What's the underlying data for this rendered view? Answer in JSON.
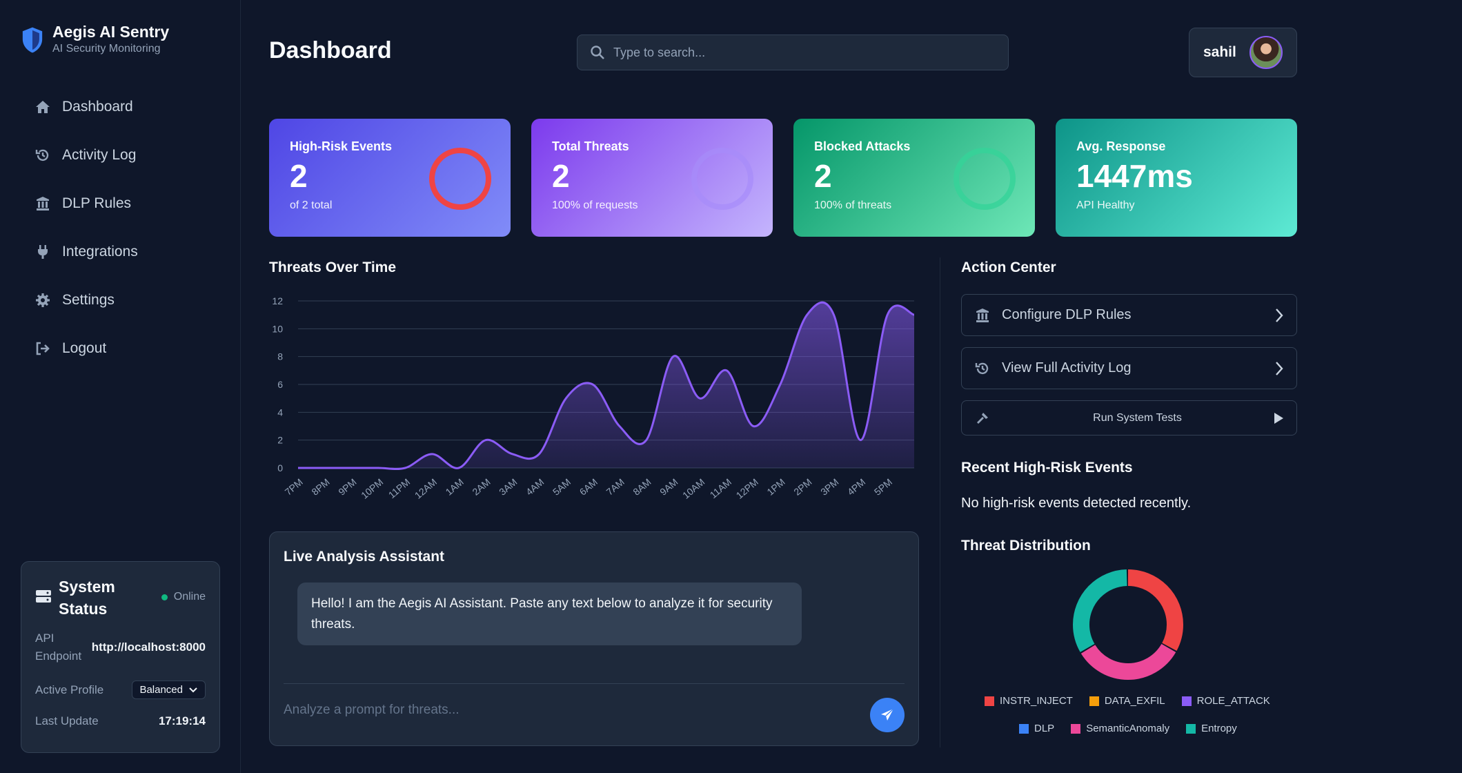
{
  "brand": {
    "title": "Aegis AI Sentry",
    "subtitle": "AI Security Monitoring"
  },
  "nav": [
    {
      "label": "Dashboard",
      "icon": "home-icon"
    },
    {
      "label": "Activity Log",
      "icon": "history-icon"
    },
    {
      "label": "DLP Rules",
      "icon": "building-icon"
    },
    {
      "label": "Integrations",
      "icon": "plug-icon"
    },
    {
      "label": "Settings",
      "icon": "gear-icon"
    },
    {
      "label": "Logout",
      "icon": "logout-icon"
    }
  ],
  "system_status": {
    "title": "System Status",
    "state": "Online",
    "api_label": "API Endpoint",
    "api_value": "http://localhost:8000",
    "profile_label": "Active Profile",
    "profile_value": "Balanced",
    "update_label": "Last Update",
    "update_value": "17:19:14"
  },
  "header": {
    "title": "Dashboard",
    "search_placeholder": "Type to search...",
    "user_name": "sahil"
  },
  "stats": [
    {
      "label": "High-Risk Events",
      "value": "2",
      "sub": "of 2 total",
      "ring_color": "#ef4444"
    },
    {
      "label": "Total Threats",
      "value": "2",
      "sub": "100% of requests",
      "ring_color": "#a78bfa"
    },
    {
      "label": "Blocked Attacks",
      "value": "2",
      "sub": "100% of threats",
      "ring_color": "#34d399"
    },
    {
      "label": "Avg. Response",
      "value": "1447ms",
      "sub": "API Healthy"
    }
  ],
  "threats_chart": {
    "title": "Threats Over Time"
  },
  "chart_data": {
    "type": "area",
    "title": "Threats Over Time",
    "categories": [
      "7PM",
      "8PM",
      "9PM",
      "10PM",
      "11PM",
      "12AM",
      "1AM",
      "2AM",
      "3AM",
      "4AM",
      "5AM",
      "6AM",
      "7AM",
      "8AM",
      "9AM",
      "10AM",
      "11AM",
      "12PM",
      "1PM",
      "2PM",
      "3PM",
      "4PM",
      "5PM"
    ],
    "values": [
      0,
      0,
      0,
      0,
      0,
      1,
      0,
      2,
      1,
      1,
      5,
      6,
      3,
      2,
      8,
      5,
      7,
      3,
      6,
      11,
      11,
      2,
      11,
      11
    ],
    "x_positions": [
      0,
      1,
      2,
      3,
      4,
      5,
      6,
      7,
      8,
      9,
      10,
      11,
      12,
      13,
      14,
      15,
      16,
      17,
      18,
      19,
      20,
      21,
      22,
      23
    ],
    "ylim": [
      0,
      12
    ],
    "yticks": [
      0,
      2,
      4,
      6,
      8,
      10,
      12
    ],
    "grid": true,
    "color": "#8b5cf6"
  },
  "assistant": {
    "title": "Live Analysis Assistant",
    "message": "Hello! I am the Aegis AI Assistant. Paste any text below to analyze it for security threats.",
    "input_placeholder": "Analyze a prompt for threats..."
  },
  "action_center": {
    "title": "Action Center",
    "actions": [
      {
        "label": "Configure DLP Rules",
        "icon": "building-icon"
      },
      {
        "label": "View Full Activity Log",
        "icon": "history-icon"
      },
      {
        "label": "Run System Tests",
        "icon": "hammer-icon"
      }
    ]
  },
  "recent_events": {
    "title": "Recent High-Risk Events",
    "empty_text": "No high-risk events detected recently."
  },
  "distribution": {
    "title": "Threat Distribution",
    "legend": [
      {
        "label": "INSTR_INJECT",
        "color": "#ef4444"
      },
      {
        "label": "DATA_EXFIL",
        "color": "#f59e0b"
      },
      {
        "label": "ROLE_ATTACK",
        "color": "#8b5cf6"
      },
      {
        "label": "DLP",
        "color": "#3b82f6"
      },
      {
        "label": "SemanticAnomaly",
        "color": "#ec4899"
      },
      {
        "label": "Entropy",
        "color": "#14b8a6"
      }
    ],
    "slices": [
      {
        "label": "INSTR_INJECT",
        "value": 1,
        "color": "#ef4444"
      },
      {
        "label": "SemanticAnomaly",
        "value": 1,
        "color": "#ec4899"
      },
      {
        "label": "Entropy",
        "value": 1,
        "color": "#14b8a6"
      }
    ]
  }
}
